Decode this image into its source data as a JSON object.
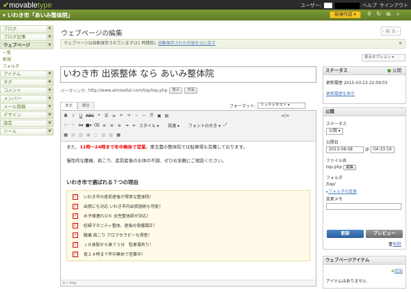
{
  "header": {
    "app_logo": "movable",
    "app_logo_suffix": "type",
    "user_label": "ユーザー:",
    "help": "ヘルプ",
    "signout": "サインアウト"
  },
  "blogbar": {
    "blog_name": "いわき市「あいみ整体院」",
    "new_button": "新規作成"
  },
  "sidebar": {
    "items": [
      {
        "label": "ブログ"
      },
      {
        "label": "ブログ記事"
      },
      {
        "label": "ウェブページ"
      }
    ],
    "sub_items": [
      {
        "label": "一覧"
      },
      {
        "label": "新規"
      },
      {
        "label": "フォルダ"
      }
    ],
    "items2": [
      {
        "label": "アイテム"
      },
      {
        "label": "タグ"
      },
      {
        "label": "コメント"
      },
      {
        "label": "メンバー"
      },
      {
        "label": "メール投稿"
      },
      {
        "label": "デザイン"
      },
      {
        "label": "設定"
      },
      {
        "label": "ツール"
      }
    ]
  },
  "main": {
    "page_title": "ウェブページの編集",
    "pager": "‹ 前 次 ›",
    "autosave_text": "ウェブページは自動保存されています(21 時間前).",
    "autosave_link": "自動保存された内容を元に戻す",
    "autosave_close": "×",
    "display_options": "表示オプション ▾",
    "title_value": "いわき市 出張整体 なら あいみ整体院",
    "permalink_label": "パーマリンク:",
    "permalink_url": "http://www.aimiseitai.com/top/top.php",
    "view_button": "表示",
    "share_button": "共有",
    "tab_body": "本文",
    "tab_more": "続き",
    "format_label": "フォーマット:",
    "format_value": "リッチテキスト",
    "toolbar": {
      "style": "スタイル",
      "paragraph": "段落",
      "font_size": "フォントの大き"
    },
    "content": {
      "line1_pre": "また、",
      "line1_red": "11時～24時まで年中無休で営業",
      "line1_post": "。東玉農の整体院では駐車場も完備しております。",
      "line2": "慢性的な腰痛、肩こり、産前産後のお体の不調、ぜひお気軽にご相談ください。",
      "heading": "いわき市で選ばれる７つの理由",
      "reasons": [
        "いわき市の産前産後が得意な整体院！",
        "出張にも対応 いわき市内出張施術も可能！",
        "お子様連れＯＫ 女性整体師が対応！",
        "妊婦マタニティ整体、産後の骨盤矯正！",
        "腰痛 肩こり アロマセラピーも得意！",
        "ＪＲ泉駅から車で３分　駐車場有り！",
        "夜２４時まで年中無休で営業中！"
      ]
    },
    "statusbar": "p » img"
  },
  "status_panel": {
    "title": "ステータス",
    "published": "公開",
    "updated_label": "更新履歴",
    "updated_value": "2015-03-23 22:09:03",
    "history_link": "更新履歴を表示"
  },
  "publish_panel": {
    "title": "公開",
    "status_label": "ステータス",
    "status_value": "公開",
    "date_label": "公開日",
    "date_value": "2013-08-08",
    "at": "@",
    "time_value": "04:33:19",
    "filename_label": "ファイル名",
    "filename_value": "top.php",
    "edit_button": "編集",
    "folder_label": "フォルダ",
    "folder_value": "/top/",
    "folder_change": "フォルダの変更",
    "memo_label": "変更メモ",
    "update_button": "更新",
    "preview_button": "プレビュー",
    "delete_link": "削除"
  },
  "items_panel": {
    "title": "ウェブページアイテム",
    "add_link": "追加",
    "empty": "アイテムはありません"
  }
}
